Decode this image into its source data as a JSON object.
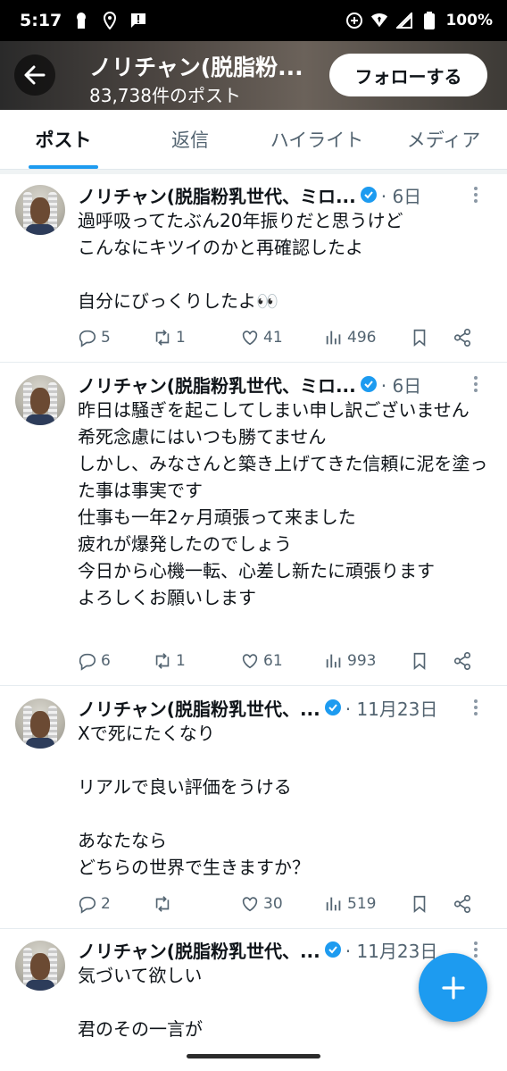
{
  "status_bar": {
    "time": "5:17",
    "battery": "100%"
  },
  "header": {
    "title": "ノリチャン(脱脂粉...",
    "post_count": "83,738件のポスト",
    "follow_label": "フォローする"
  },
  "tabs": [
    {
      "label": "ポスト",
      "active": true
    },
    {
      "label": "返信",
      "active": false
    },
    {
      "label": "ハイライト",
      "active": false
    },
    {
      "label": "メディア",
      "active": false
    }
  ],
  "posts": [
    {
      "name": "ノリチャン(脱脂粉乳世代、ミロ...",
      "date": "· 6日",
      "text": "過呼吸ってたぶん20年振りだと思うけど\nこんなにキツイのかと再確認したよ\n\n自分にびっくりしたよ👀",
      "replies": "5",
      "reposts": "1",
      "likes": "41",
      "views": "496"
    },
    {
      "name": "ノリチャン(脱脂粉乳世代、ミロ...",
      "date": "· 6日",
      "text": "昨日は騒ぎを起こしてしまい申し訳ございません\n希死念慮にはいつも勝てません\nしかし、みなさんと築き上げてきた信頼に泥を塗った事は事実です\n仕事も一年2ヶ月頑張って来ました\n疲れが爆発したのでしょう\n今日から心機一転、心差し新たに頑張ります\nよろしくお願いします",
      "replies": "6",
      "reposts": "1",
      "likes": "61",
      "views": "993"
    },
    {
      "name": "ノリチャン(脱脂粉乳世代、...",
      "date": "· 11月23日",
      "text": "Xで死にたくなり\n\nリアルで良い評価をうける\n\nあなたなら\nどちらの世界で生きますか？",
      "replies": "2",
      "reposts": "",
      "likes": "30",
      "views": "519"
    },
    {
      "name": "ノリチャン(脱脂粉乳世代、...",
      "date": "· 11月23日",
      "text": "気づいて欲しい\n\n君のその一言が",
      "replies": "",
      "reposts": "",
      "likes": "",
      "views": ""
    }
  ],
  "colors": {
    "accent": "#1d9bf0",
    "text": "#0f1419",
    "muted": "#536471"
  }
}
